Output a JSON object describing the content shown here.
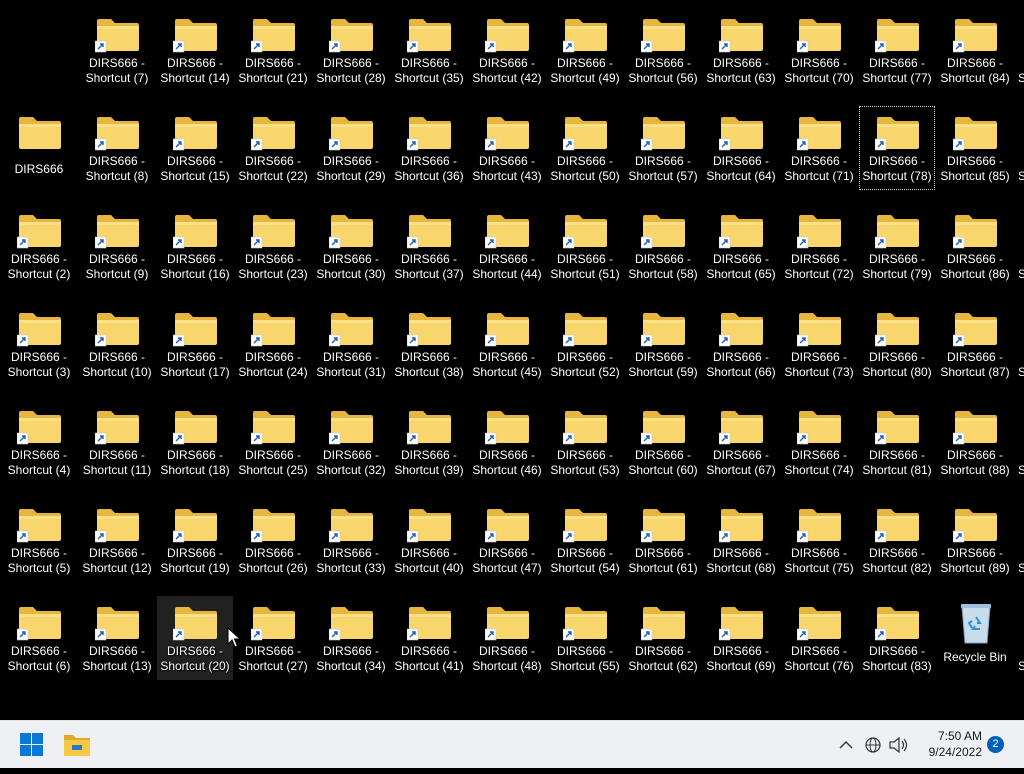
{
  "desktop": {
    "shortcut_prefix": "DIRS666 -",
    "shortcut_word": "Shortcut",
    "original_folder": "DIRS666",
    "recycle_bin": "Recycle Bin",
    "selected_icon": "DIRS666 - Shortcut (78)",
    "hovered_icon": "DIRS666 - Shortcut (20)",
    "columns": [
      [
        null,
        "DIRS666",
        2,
        3,
        4,
        5,
        6
      ],
      [
        7,
        8,
        9,
        10,
        11,
        12,
        13
      ],
      [
        14,
        15,
        16,
        17,
        18,
        19,
        20
      ],
      [
        21,
        22,
        23,
        24,
        25,
        26,
        27
      ],
      [
        28,
        29,
        30,
        31,
        32,
        33,
        34
      ],
      [
        35,
        36,
        37,
        38,
        39,
        40,
        41
      ],
      [
        42,
        43,
        44,
        45,
        46,
        47,
        48
      ],
      [
        49,
        50,
        51,
        52,
        53,
        54,
        55
      ],
      [
        56,
        57,
        58,
        59,
        60,
        61,
        62
      ],
      [
        63,
        64,
        65,
        66,
        67,
        68,
        69
      ],
      [
        70,
        71,
        72,
        73,
        74,
        75,
        76
      ],
      [
        77,
        78,
        79,
        80,
        81,
        82,
        83
      ],
      [
        84,
        85,
        86,
        87,
        88,
        89,
        "Recycle Bin"
      ]
    ],
    "partial_column_glyph": "S"
  },
  "taskbar": {
    "start_icon": "windows-start-icon",
    "pinned": [
      "file-explorer-icon"
    ],
    "tray_icons": [
      "show-hidden-icons-chevron",
      "network-globe-icon",
      "volume-icon"
    ],
    "time": "7:50 AM",
    "date": "9/24/2022",
    "notification_count": "2"
  },
  "colors": {
    "desktop_bg": "#000000",
    "taskbar_bg": "#eef0f3",
    "folder_yellow": "#f8d66b",
    "accent": "#005fb8"
  }
}
